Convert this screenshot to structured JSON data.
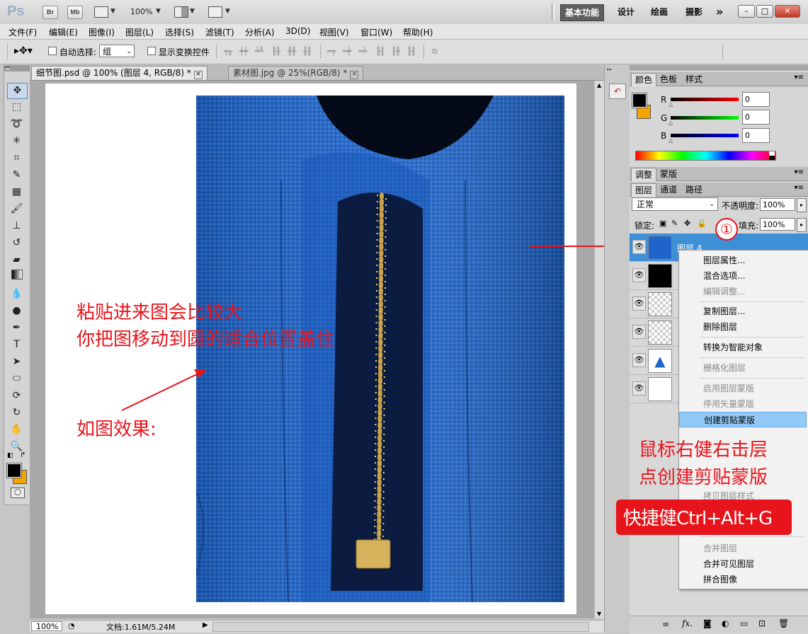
{
  "app": {
    "logo": "Ps",
    "launch_buttons": [
      "Br",
      "Mb"
    ],
    "zoom_label": "100%",
    "workspaces": [
      "基本功能",
      "设计",
      "绘画",
      "摄影"
    ],
    "more_glyph": "»"
  },
  "menu": [
    "文件(F)",
    "编辑(E)",
    "图像(I)",
    "图层(L)",
    "选择(S)",
    "滤镜(T)",
    "分析(A)",
    "3D(D)",
    "视图(V)",
    "窗口(W)",
    "帮助(H)"
  ],
  "options": {
    "auto_select_label": "自动选择:",
    "auto_select_value": "组",
    "show_transform_label": "显示变换控件"
  },
  "documents": {
    "active_tab": "细节图.psd @ 100% (图层 4, RGB/8) *",
    "second_tab": "素材图.jpg @ 25%(RGB/8) *"
  },
  "status": {
    "zoom": "100%",
    "doc_info": "文档:1.61M/5.24M"
  },
  "color_panel": {
    "tabs": [
      "颜色",
      "色板",
      "样式"
    ],
    "channels": [
      {
        "label": "R",
        "value": "0"
      },
      {
        "label": "G",
        "value": "0"
      },
      {
        "label": "B",
        "value": "0"
      }
    ],
    "foreground": "#000000",
    "background": "#f5a300"
  },
  "adjust_panel": {
    "tabs": [
      "调整",
      "蒙版"
    ]
  },
  "layers_panel": {
    "tabs": [
      "图层",
      "通道",
      "路径"
    ],
    "blend_mode": "正常",
    "opacity_label": "不透明度:",
    "opacity_value": "100%",
    "lock_label": "锁定:",
    "fill_label": "填充:",
    "fill_value": "100%",
    "selected_layer_name": "图层 4",
    "footer_icons": [
      "link-icon",
      "fx-icon",
      "mask-icon",
      "adjustment-icon",
      "folder-icon",
      "new-layer-icon",
      "trash-icon"
    ]
  },
  "context_menu": {
    "items": [
      {
        "label": "图层属性...",
        "state": "enabled"
      },
      {
        "label": "混合选项...",
        "state": "enabled"
      },
      {
        "label": "编辑调整...",
        "state": "disabled"
      },
      {
        "label": "复制图层...",
        "state": "enabled"
      },
      {
        "label": "删除图层",
        "state": "enabled"
      },
      {
        "label": "转换为智能对象",
        "state": "enabled"
      },
      {
        "label": "栅格化图层",
        "state": "disabled"
      },
      {
        "label": "启用图层蒙版",
        "state": "disabled"
      },
      {
        "label": "停用矢量蒙版",
        "state": "disabled"
      },
      {
        "label": "创建剪贴蒙版",
        "state": "highlighted"
      },
      {
        "label": "拷贝图层样式",
        "state": "disabled"
      },
      {
        "label": "合并图层",
        "state": "disabled"
      },
      {
        "label": "合并可见图层",
        "state": "enabled"
      },
      {
        "label": "拼合图像",
        "state": "enabled"
      }
    ]
  },
  "annotations": {
    "paste_line1": "粘贴进来图会比较大",
    "paste_line2": "你把图移动到圆的适合位置盖住",
    "effect": "如图效果:",
    "step_marker": "①",
    "rightclick_line1": "鼠标右健右击层",
    "rightclick_line2": "点创建剪贴蒙版",
    "shortcut": "快捷健Ctrl+Alt+G",
    "color": "#e8141b"
  }
}
